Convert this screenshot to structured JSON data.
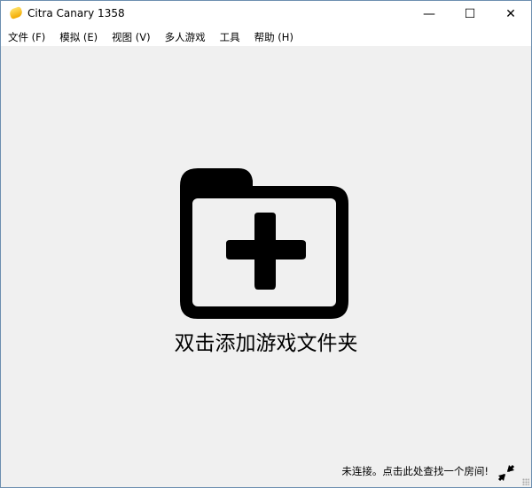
{
  "window": {
    "title": "Citra Canary 1358",
    "minimize": "—",
    "maximize": "☐",
    "close": "✕"
  },
  "menu": [
    {
      "label": "文件 (F)"
    },
    {
      "label": "模拟 (E)"
    },
    {
      "label": "视图 (V)"
    },
    {
      "label": "多人游戏"
    },
    {
      "label": "工具"
    },
    {
      "label": "帮助 (H)"
    }
  ],
  "main": {
    "caption": "双击添加游戏文件夹",
    "icon": "folder-add-icon"
  },
  "status": {
    "text": "未连接。点击此处查找一个房间!",
    "icon": "network-disconnected-icon"
  }
}
